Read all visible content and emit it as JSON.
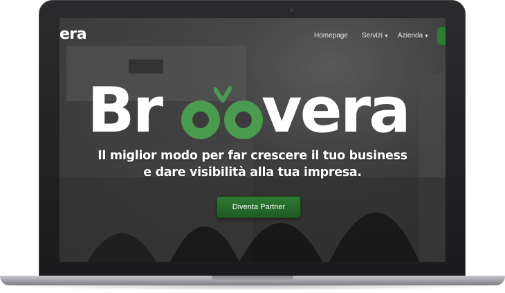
{
  "header": {
    "logo_partial": "era",
    "nav": [
      {
        "label": "Homepage",
        "has_dropdown": false
      },
      {
        "label": "Servizi",
        "has_dropdown": true
      },
      {
        "label": "Azienda",
        "has_dropdown": true
      }
    ]
  },
  "hero": {
    "brand_left": "Br",
    "brand_right": "vera",
    "brand_name": "Broovera",
    "tagline_line1": "Il miglior modo per far crescere il tuo business",
    "tagline_line2": "e dare visibilità alla tua impresa.",
    "cta_label": "Diventa Partner"
  },
  "colors": {
    "accent_green": "#4a9a4f",
    "button_green": "#2f7a35",
    "text": "#ffffff"
  },
  "icons": [
    "caret-down-icon",
    "checkmark-icon"
  ]
}
